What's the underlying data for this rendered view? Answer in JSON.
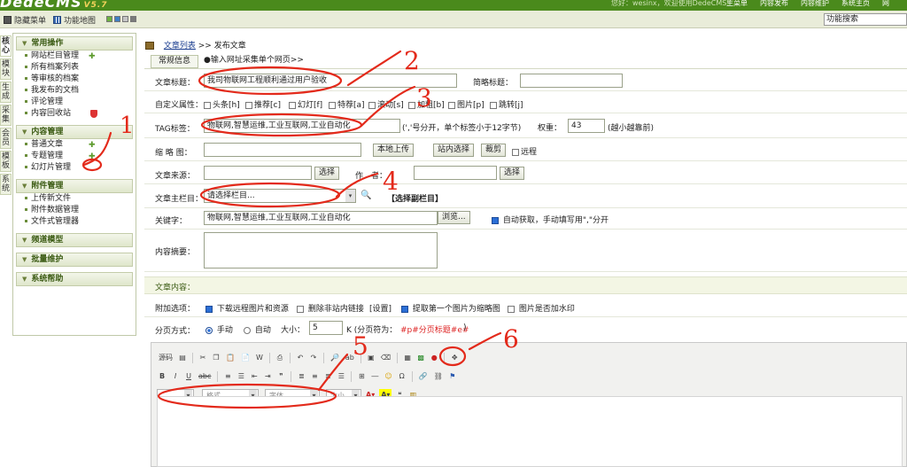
{
  "topbar": {
    "logo": "DedeCMS",
    "version": "V5.7",
    "welcome": "您好：wesinx，欢迎使用DedeCMS!",
    "nav": [
      "主菜单",
      "内容发布",
      "内容维护",
      "系统主页",
      "网"
    ]
  },
  "subbar": {
    "hide_menu": "隐藏菜单",
    "site_map": "功能地图",
    "search_value": "功能搜索"
  },
  "vtabs": [
    "核心",
    "模块",
    "生成",
    "采集",
    "会员",
    "模板",
    "系统"
  ],
  "menu": {
    "sec1": {
      "title": "常用操作",
      "items": [
        "网站栏目管理",
        "所有档案列表",
        "等审核的档案",
        "我发布的文档",
        "评论管理",
        "内容回收站"
      ]
    },
    "sec2": {
      "title": "内容管理",
      "items": [
        "普通文章",
        "专题管理",
        "幻灯片管理"
      ]
    },
    "sec3": {
      "title": "附件管理",
      "items": [
        "上传新文件",
        "附件数据管理",
        "文件式管理器"
      ]
    },
    "sec4": {
      "title": "频道模型"
    },
    "sec5": {
      "title": "批量维护"
    },
    "sec6": {
      "title": "系统帮助"
    }
  },
  "breadcrumb": {
    "link": "文章列表",
    "sep": ">>",
    "current": "发布文章"
  },
  "tabs": {
    "basic": "常规信息",
    "collect": "●输入网址采集单个网页>>"
  },
  "form": {
    "title_label": "文章标题：",
    "title_value": "我司物联网工程顺利通过用户验收",
    "short_title_label": "简略标题：",
    "attr_label": "自定义属性：",
    "attrs": [
      "头条[h]",
      "推荐[c]",
      "幻灯[f]",
      "特荐[a]",
      "滚动[s]",
      "加粗[b]",
      "图片[p]",
      "跳转[j]"
    ],
    "tag_label": "TAG标签：",
    "tag_value": "物联网,智慧运维,工业互联网,工业自动化",
    "tag_hint": "(','号分开，单个标签小于12字节)",
    "weight_label": "权重：",
    "weight_value": "43",
    "weight_hint": "(越小越靠前)",
    "thumb_label": "缩 略 图：",
    "upload_btn": "本地上传",
    "site_select_btn": "站内选择",
    "crop_btn": "裁剪",
    "remote_label": "远程",
    "source_label": "文章来源：",
    "source_select": "选择",
    "author_label": "作　者：",
    "author_select": "选择",
    "column_label": "文章主栏目：",
    "column_value": "请选择栏目...",
    "sub_column": "【选择副栏目】",
    "keywords_label": "关键字：",
    "keywords_value": "物联网,智慧运维,工业互联网,工业自动化",
    "browse_btn": "浏览...",
    "auto_fetch": "自动获取，手动填写用\",\"分开",
    "summary_label": "内容摘要：",
    "content_label": "文章内容：",
    "extra_label": "附加选项：",
    "extra_opts": [
      "下载远程图片和资源",
      "删除非站内链接",
      "[设置]",
      "提取第一个图片为缩略图",
      "图片是否加水印"
    ],
    "paging_label": "分页方式：",
    "manual": "手动",
    "auto": "自动",
    "size_label": "大小：",
    "size_value": "5",
    "size_unit": "K (分页符为：",
    "page_mark": "#p#分页标题#e#",
    "page_end": ")"
  },
  "editor": {
    "source": "源码",
    "format": "格式",
    "font": "字体",
    "size": "大小"
  },
  "annotations": [
    "1",
    "2",
    "3",
    "4",
    "5",
    "6"
  ]
}
